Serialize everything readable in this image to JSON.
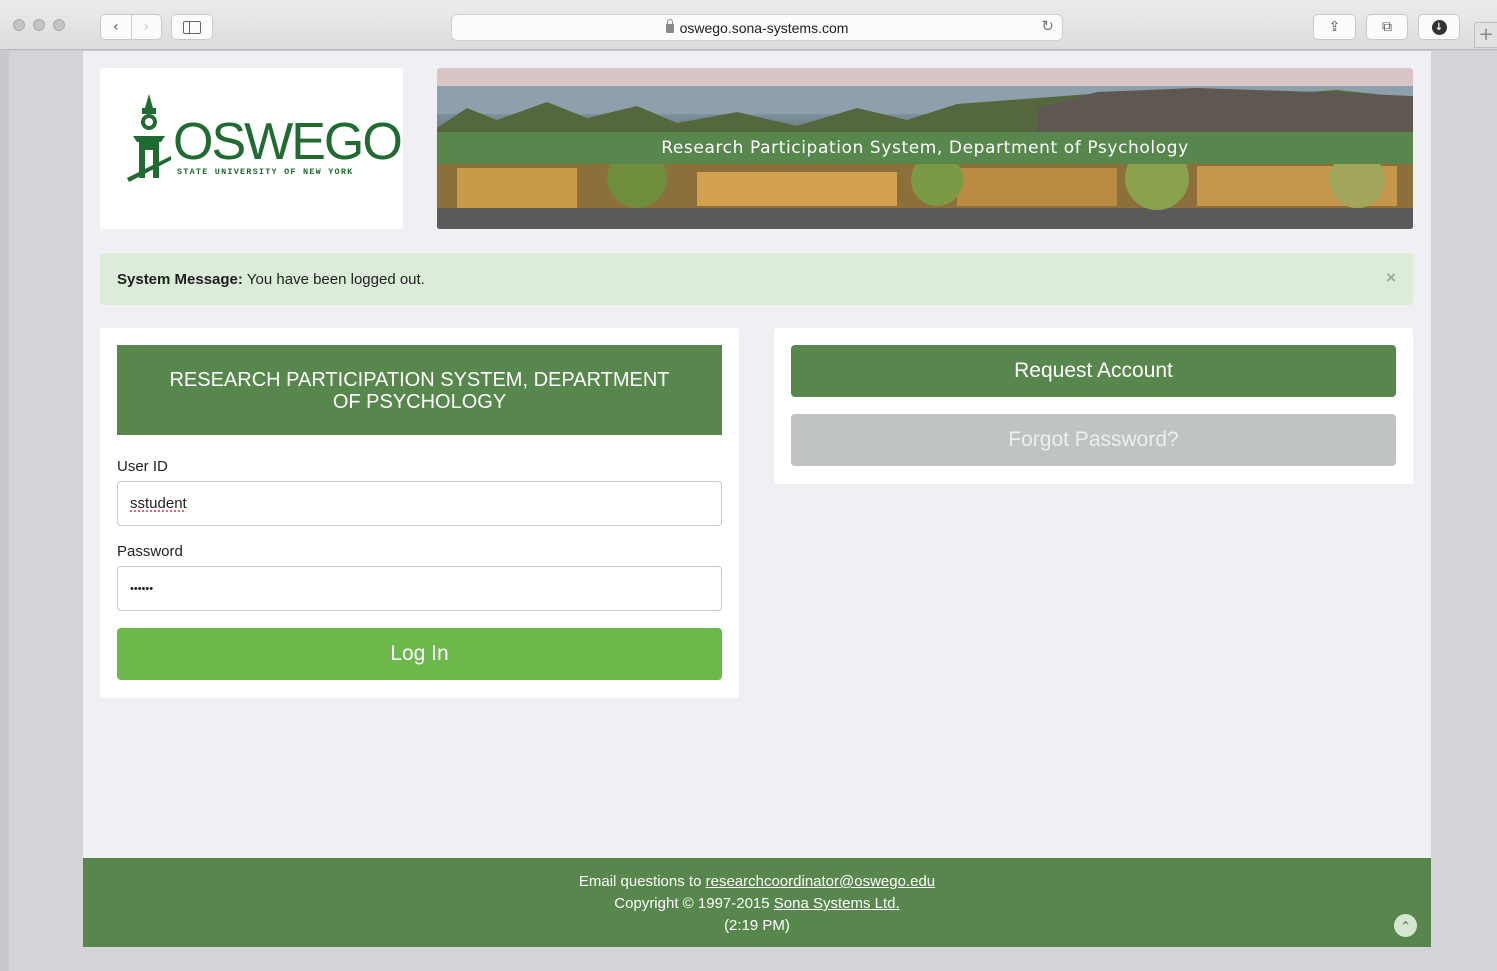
{
  "browser": {
    "url": "oswego.sona-systems.com",
    "back_glyph": "‹",
    "forward_glyph": "›",
    "reload_glyph": "↻",
    "share_glyph": "⇪",
    "tabs_glyph": "⧉",
    "download_glyph": "↓",
    "newtab_glyph": "+"
  },
  "logo": {
    "wordmark": "OSWEGO",
    "subtitle": "STATE UNIVERSITY OF NEW YORK"
  },
  "banner": {
    "title": "Research Participation System, Department of Psychology"
  },
  "alert": {
    "label": "System Message:",
    "message": "You have been logged out.",
    "close_glyph": "×"
  },
  "login": {
    "header": "RESEARCH PARTICIPATION SYSTEM, DEPARTMENT OF PSYCHOLOGY",
    "user_id_label": "User ID",
    "user_id_value": "sstudent",
    "password_label": "Password",
    "password_value": "••••••",
    "submit_label": "Log In"
  },
  "side": {
    "request_label": "Request Account",
    "forgot_label": "Forgot Password?"
  },
  "footer": {
    "email_prefix": "Email questions to",
    "email": "researchcoordinator@oswego.edu",
    "copyright_prefix": "Copyright © 1997-2015",
    "company": "Sona Systems Ltd.",
    "time": "(2:19 PM)",
    "to_top_glyph": "⌃"
  },
  "colors": {
    "brand_green": "#57874c",
    "login_green": "#6db84a",
    "alert_bg": "#dbecd8",
    "disabled_gray": "#bfc3c3"
  }
}
